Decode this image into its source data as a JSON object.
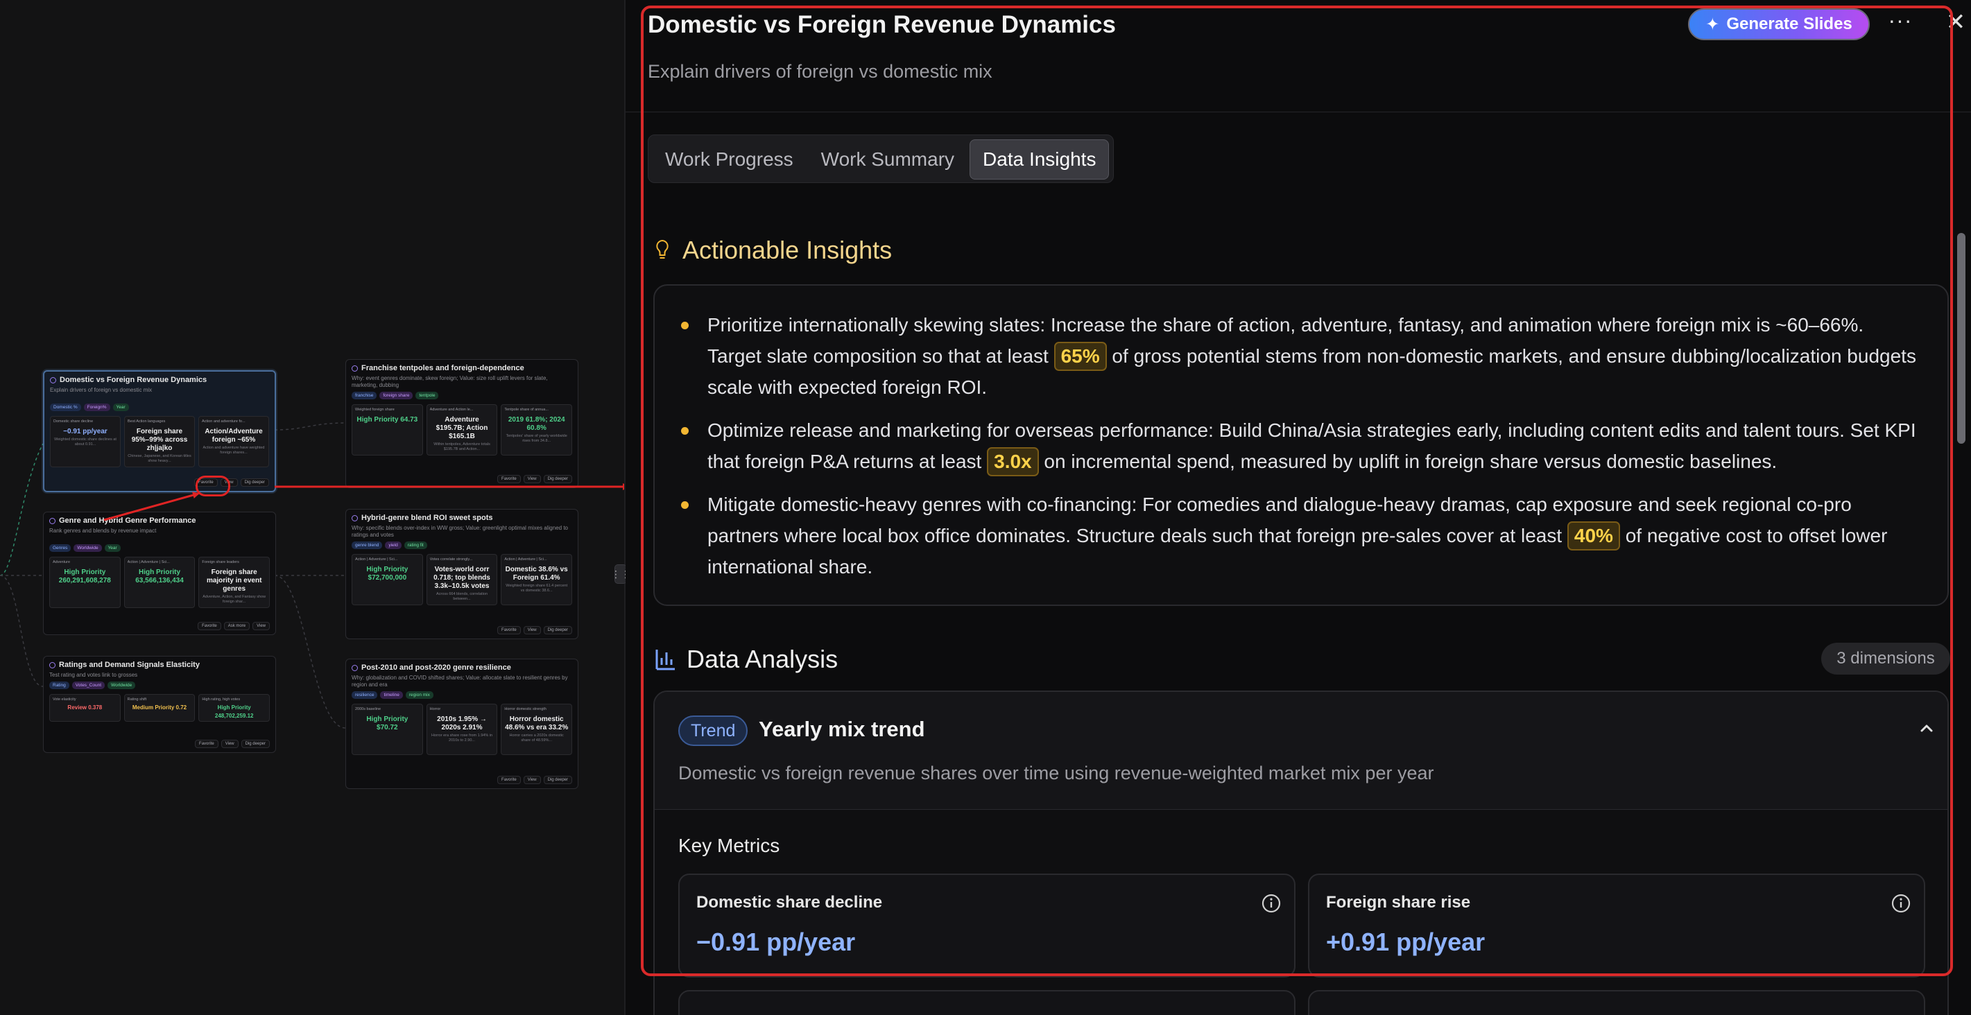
{
  "canvas": {
    "cards": [
      {
        "title": "Domestic vs Foreign Revenue Dynamics",
        "subtitle": "Explain drivers of foreign vs domestic mix",
        "tags": [
          "Domestic %",
          "Foreign%",
          "Year"
        ],
        "minis": [
          {
            "head": "Domestic share decline",
            "value": "−0.91 pp/year",
            "sub": "Weighted domestic share declines at about 0.91..."
          },
          {
            "head": "Best Action languages",
            "value": "Foreign share 95%–99% across zh|ja|ko",
            "sub": "Chinese, Japanese, and Korean titles show heavy..."
          },
          {
            "head": "Action and adventure fo...",
            "value": "Action/Adventure foreign ~65%",
            "sub": "Action and adventure have weighted foreign shares..."
          }
        ],
        "actions": [
          "Favorite",
          "View",
          "Dig deeper"
        ]
      },
      {
        "title": "Franchise tentpoles and foreign-dependence",
        "subtitle": "Why: event genres dominate, skew foreign; Value: size roll uplift levers for slate, marketing, dubbing",
        "tags": [
          "franchise",
          "foreign share",
          "tentpole"
        ],
        "minis": [
          {
            "head": "Weighted foreign share",
            "value": "High Priority 64.73",
            "sub": ""
          },
          {
            "head": "Adventure and Action le...",
            "value": "Adventure $195.7B; Action $165.1B",
            "sub": "Within tentpoles, Adventure totals $195.7B and Action..."
          },
          {
            "head": "Tentpole share of annua...",
            "value": "2019 61.8%; 2024 60.8%",
            "sub": "Tentpoles' share of yearly worldwide rises from 34.8..."
          }
        ],
        "actions": [
          "Favorite",
          "View",
          "Dig deeper"
        ]
      },
      {
        "title": "Genre and Hybrid Genre Performance",
        "subtitle": "Rank genres and blends by revenue impact",
        "tags": [
          "Genres",
          "Worldwide",
          "Year"
        ],
        "minis": [
          {
            "head": "Adventure",
            "value": "High Priority 260,291,608,278",
            "sub": ""
          },
          {
            "head": "Action | Adventure | Sci...",
            "value": "High Priority 63,566,136,434",
            "sub": ""
          },
          {
            "head": "Foreign share leaders",
            "value": "Foreign share majority in event genres",
            "sub": "Adventure, Action, and Fantasy show foreign shar..."
          }
        ],
        "actions": [
          "Favorite",
          "Ask more",
          "View"
        ]
      },
      {
        "title": "Hybrid-genre blend ROI sweet spots",
        "subtitle": "Why: specific blends over-index in WW gross; Value: greenlight optimal mixes aligned to ratings and votes",
        "tags": [
          "genre blend",
          "yield",
          "rating fit"
        ],
        "minis": [
          {
            "head": "Action | Adventure | Sci...",
            "value": "High Priority $72,700,000",
            "sub": ""
          },
          {
            "head": "Votes correlate strongly...",
            "value": "Votes-world corr 0.718; top blends 3.3k–10.5k votes",
            "sub": "Across 664 blends, correlation between..."
          },
          {
            "head": "Action | Adventure | Sci...",
            "value": "Domestic 38.6% vs Foreign 61.4%",
            "sub": "Weighted foreign share 61.4 percent vs domestic 38.6..."
          }
        ],
        "actions": [
          "Favorite",
          "View",
          "Dig deeper"
        ]
      },
      {
        "title": "Ratings and Demand Signals Elasticity",
        "subtitle": "Test rating and votes link to grosses",
        "tags": [
          "Rating",
          "Votes_Count",
          "Worldwide"
        ],
        "minis": [
          {
            "head": "Vote elasticity",
            "value": "Review 0.378",
            "sub": ""
          },
          {
            "head": "Rating shift",
            "value": "Medium Priority 0.72",
            "sub": ""
          },
          {
            "head": "High rating, high votes",
            "value": "High Priority 248,702,259.12",
            "sub": ""
          }
        ],
        "actions": [
          "Favorite",
          "View",
          "Dig deeper"
        ]
      },
      {
        "title": "Post-2010 and post-2020 genre resilience",
        "subtitle": "Why: globalization and COVID shifted shares; Value: allocate slate to resilient genres by region and era",
        "tags": [
          "resilience",
          "timeline",
          "region mix"
        ],
        "minis": [
          {
            "head": "2000s baseline",
            "value": "High Priority $70.72",
            "sub": ""
          },
          {
            "head": "Horror",
            "value": "2010s 1.95% → 2020s 2.91%",
            "sub": "Horror era share rose from 1.94% in 2010s to 2.90..."
          },
          {
            "head": "Horror domestic strength",
            "value": "Horror domestic 48.6% vs era 33.2%",
            "sub": "Horror carries a 2020s domestic share of 48.59%..."
          }
        ],
        "actions": [
          "Favorite",
          "View",
          "Dig deeper"
        ]
      }
    ]
  },
  "panel": {
    "title": "Domestic vs Foreign Revenue Dynamics",
    "subtitle": "Explain drivers of foreign vs domestic mix",
    "generate_label": "Generate Slides",
    "tabs": [
      "Work Progress",
      "Work Summary",
      "Data Insights"
    ],
    "active_tab": "Data Insights",
    "insights_title": "Actionable Insights",
    "insights": [
      {
        "pre": "Prioritize internationally skewing slates: Increase the share of action, adventure, fantasy, and animation where foreign mix is ~60–66%. Target slate composition so that at least ",
        "highlight": "65%",
        "post": " of gross potential stems from non-domestic markets, and ensure dubbing/localization budgets scale with expected foreign ROI."
      },
      {
        "pre": "Optimize release and marketing for overseas performance: Build China/Asia strategies early, including content edits and talent tours. Set KPI that foreign P&A returns at least ",
        "highlight": "3.0x",
        "post": " on incremental spend, measured by uplift in foreign share versus domestic baselines."
      },
      {
        "pre": "Mitigate domestic-heavy genres with co-financing: For comedies and dialogue-heavy dramas, cap exposure and seek regional co-pro partners where local box office dominates. Structure deals such that foreign pre-sales cover at least ",
        "highlight": "40%",
        "post": " of negative cost to offset lower international share."
      }
    ],
    "analysis_title": "Data Analysis",
    "dimensions_badge": "3 dimensions",
    "dimension": {
      "tag": "Trend",
      "title": "Yearly mix trend",
      "description": "Domestic vs foreign revenue shares over time using revenue-weighted market mix per year",
      "key_metrics_title": "Key Metrics",
      "metrics": [
        {
          "label": "Domestic share decline",
          "value": "−0.91 pp/year"
        },
        {
          "label": "Foreign share rise",
          "value": "+0.91 pp/year"
        }
      ]
    }
  },
  "colors": {
    "accent_blue": "#8fb3ff",
    "highlight_yellow": "#ffd24a",
    "insight_title": "#f4d58d",
    "annotation_red": "#d92a2a"
  }
}
